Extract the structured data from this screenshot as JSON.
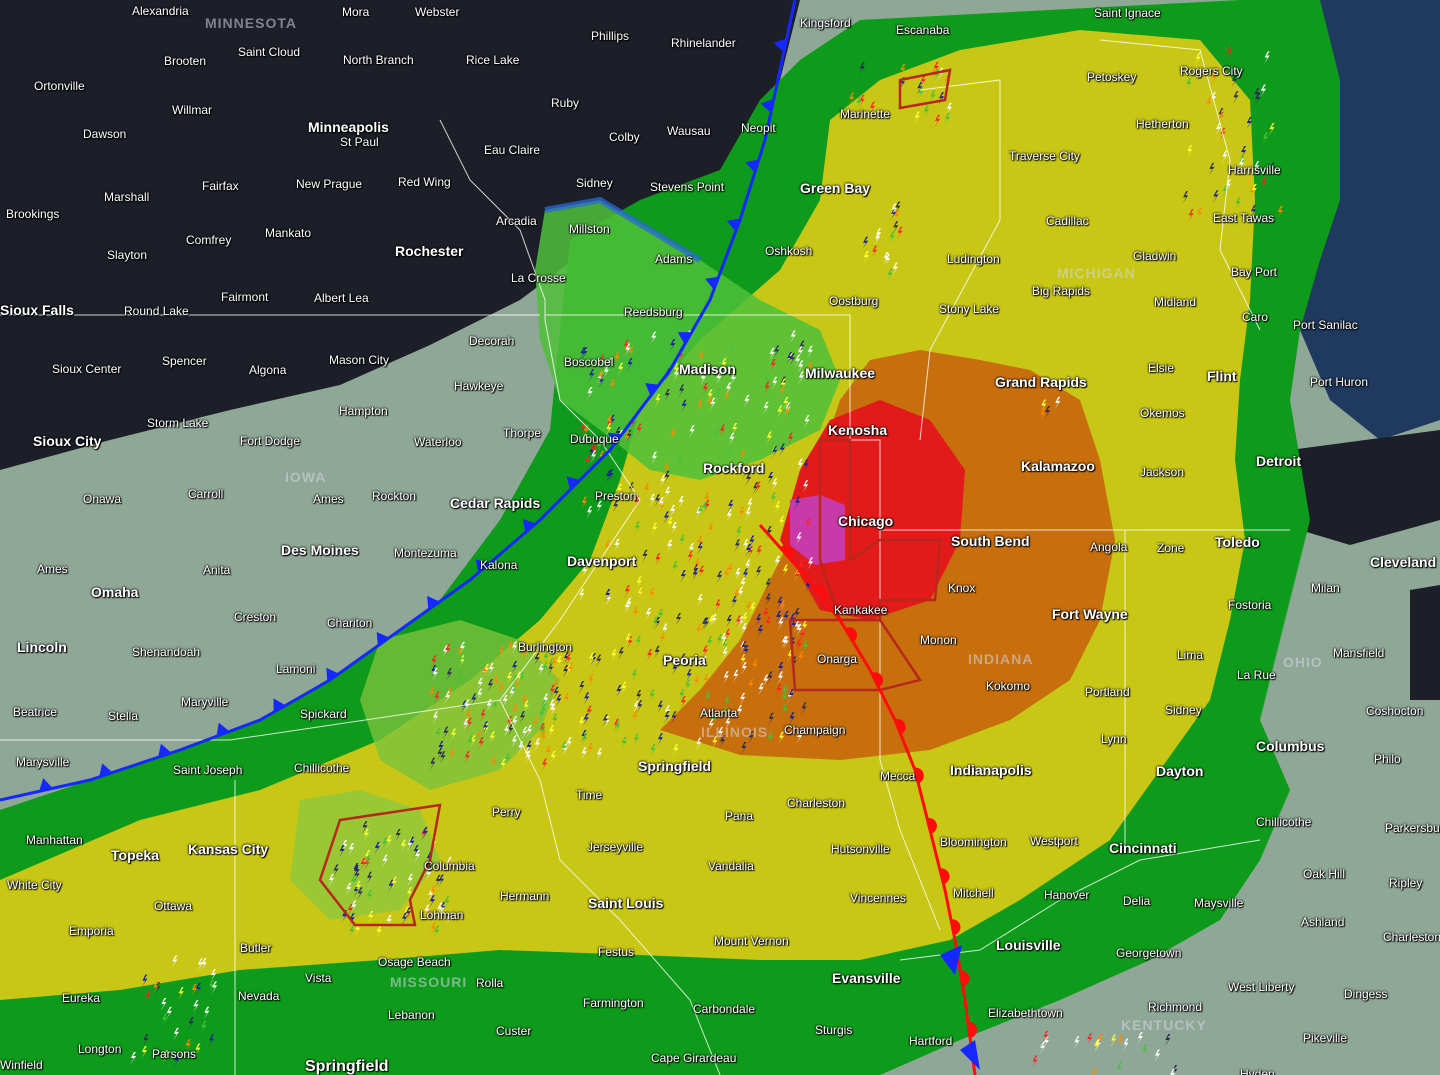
{
  "map": {
    "colors": {
      "background": "#1c1f28",
      "lake": "#1f3a5e",
      "risk_marginal": "#8fa796",
      "risk_general": "#0e9a1a",
      "risk_slight": "#c8c715",
      "risk_enhanced": "#c76e0d",
      "risk_moderate": "#e31a1a",
      "risk_high": "#c83aa8",
      "cold_front": "#1428ff",
      "warm_front": "#ff0c0c",
      "warning_polygon": "#b7271b",
      "state_border": "#ffffff"
    },
    "state_labels": [
      "MINNESOTA",
      "IOWA",
      "ILLINOIS",
      "INDIANA",
      "MICHIGAN",
      "MISSOURI",
      "OHIO",
      "KENTUCKY"
    ],
    "cities": [
      {
        "id": "alexandria",
        "name": "Alexandria"
      },
      {
        "id": "mora",
        "name": "Mora"
      },
      {
        "id": "webster",
        "name": "Webster"
      },
      {
        "id": "kingsford",
        "name": "Kingsford"
      },
      {
        "id": "escanaba",
        "name": "Escanaba"
      },
      {
        "id": "saint-ignace",
        "name": "Saint Ignace"
      },
      {
        "id": "saint-cloud",
        "name": "Saint Cloud"
      },
      {
        "id": "brooten",
        "name": "Brooten"
      },
      {
        "id": "north-branch",
        "name": "North Branch"
      },
      {
        "id": "phillips",
        "name": "Phillips"
      },
      {
        "id": "rhinelander",
        "name": "Rhinelander"
      },
      {
        "id": "rice-lake",
        "name": "Rice Lake"
      },
      {
        "id": "petoskey",
        "name": "Petoskey"
      },
      {
        "id": "rogers-city",
        "name": "Rogers City"
      },
      {
        "id": "ortonville",
        "name": "Ortonville"
      },
      {
        "id": "willmar",
        "name": "Willmar"
      },
      {
        "id": "ruby",
        "name": "Ruby"
      },
      {
        "id": "menominee-hint",
        "name": "Marinette"
      },
      {
        "id": "minneapolis",
        "name": "Minneapolis"
      },
      {
        "id": "st-paul",
        "name": "St Paul"
      },
      {
        "id": "eau-claire",
        "name": "Eau Claire"
      },
      {
        "id": "wausau",
        "name": "Wausau"
      },
      {
        "id": "neopit",
        "name": "Neopit"
      },
      {
        "id": "colby",
        "name": "Colby"
      },
      {
        "id": "hetherton",
        "name": "Hetherton"
      },
      {
        "id": "dawson",
        "name": "Dawson"
      },
      {
        "id": "traverse-city",
        "name": "Traverse City"
      },
      {
        "id": "harrisville",
        "name": "Harrisville"
      },
      {
        "id": "fairfax",
        "name": "Fairfax"
      },
      {
        "id": "new-prague",
        "name": "New Prague"
      },
      {
        "id": "red-wing",
        "name": "Red Wing"
      },
      {
        "id": "sidney-wi",
        "name": "Sidney"
      },
      {
        "id": "stevens-point",
        "name": "Stevens Point"
      },
      {
        "id": "green-bay",
        "name": "Green Bay"
      },
      {
        "id": "marshall",
        "name": "Marshall"
      },
      {
        "id": "brookings",
        "name": "Brookings"
      },
      {
        "id": "cadillac",
        "name": "Cadillac"
      },
      {
        "id": "east-tawas",
        "name": "East Tawas"
      },
      {
        "id": "arcadia",
        "name": "Arcadia"
      },
      {
        "id": "millston",
        "name": "Millston"
      },
      {
        "id": "mankato",
        "name": "Mankato"
      },
      {
        "id": "comfrey",
        "name": "Comfrey"
      },
      {
        "id": "rochester",
        "name": "Rochester"
      },
      {
        "id": "oshkosh",
        "name": "Oshkosh"
      },
      {
        "id": "slayton",
        "name": "Slayton"
      },
      {
        "id": "adams",
        "name": "Adams"
      },
      {
        "id": "ludington",
        "name": "Ludington"
      },
      {
        "id": "gladwin",
        "name": "Gladwin"
      },
      {
        "id": "bay-port",
        "name": "Bay Port"
      },
      {
        "id": "la-crosse",
        "name": "La Crosse"
      },
      {
        "id": "fairmont",
        "name": "Fairmont"
      },
      {
        "id": "albert-lea",
        "name": "Albert Lea"
      },
      {
        "id": "big-rapids",
        "name": "Big Rapids"
      },
      {
        "id": "sioux-falls",
        "name": "Sioux Falls"
      },
      {
        "id": "round-lake",
        "name": "Round Lake"
      },
      {
        "id": "oostburg",
        "name": "Oostburg"
      },
      {
        "id": "midland",
        "name": "Midland"
      },
      {
        "id": "reedsburg",
        "name": "Reedsburg"
      },
      {
        "id": "stony-lake",
        "name": "Stony Lake"
      },
      {
        "id": "caro",
        "name": "Caro"
      },
      {
        "id": "port-sanilac",
        "name": "Port Sanilac"
      },
      {
        "id": "decorah",
        "name": "Decorah"
      },
      {
        "id": "spencer",
        "name": "Spencer"
      },
      {
        "id": "mason-city",
        "name": "Mason City"
      },
      {
        "id": "boscobel",
        "name": "Boscobel"
      },
      {
        "id": "madison",
        "name": "Madison"
      },
      {
        "id": "sioux-center",
        "name": "Sioux Center"
      },
      {
        "id": "algona",
        "name": "Algona"
      },
      {
        "id": "milwaukee",
        "name": "Milwaukee"
      },
      {
        "id": "elsie",
        "name": "Elsie"
      },
      {
        "id": "flint",
        "name": "Flint"
      },
      {
        "id": "port-huron",
        "name": "Port Huron"
      },
      {
        "id": "hawkeye",
        "name": "Hawkeye"
      },
      {
        "id": "grand-rapids",
        "name": "Grand Rapids"
      },
      {
        "id": "hampton",
        "name": "Hampton"
      },
      {
        "id": "okemos",
        "name": "Okemos"
      },
      {
        "id": "storm-lake",
        "name": "Storm Lake"
      },
      {
        "id": "kenosha",
        "name": "Kenosha"
      },
      {
        "id": "sioux-city",
        "name": "Sioux City"
      },
      {
        "id": "thorpe",
        "name": "Thorpe"
      },
      {
        "id": "dubuque",
        "name": "Dubuque"
      },
      {
        "id": "fort-dodge",
        "name": "Fort Dodge"
      },
      {
        "id": "waterloo",
        "name": "Waterloo"
      },
      {
        "id": "detroit",
        "name": "Detroit"
      },
      {
        "id": "kalamazoo",
        "name": "Kalamazoo"
      },
      {
        "id": "rockford",
        "name": "Rockford"
      },
      {
        "id": "jackson",
        "name": "Jackson"
      },
      {
        "id": "onawa",
        "name": "Onawa"
      },
      {
        "id": "carroll",
        "name": "Carroll"
      },
      {
        "id": "ames",
        "name": "Ames"
      },
      {
        "id": "rockton",
        "name": "Rockton"
      },
      {
        "id": "preston",
        "name": "Preston"
      },
      {
        "id": "cedar-rapids",
        "name": "Cedar Rapids"
      },
      {
        "id": "chicago",
        "name": "Chicago"
      },
      {
        "id": "south-bend",
        "name": "South Bend"
      },
      {
        "id": "angola",
        "name": "Angola"
      },
      {
        "id": "zone",
        "name": "Zone"
      },
      {
        "id": "toledo",
        "name": "Toledo"
      },
      {
        "id": "des-moines",
        "name": "Des Moines"
      },
      {
        "id": "montezuma",
        "name": "Montezuma"
      },
      {
        "id": "cleveland",
        "name": "Cleveland"
      },
      {
        "id": "davenport",
        "name": "Davenport"
      },
      {
        "id": "ames-ne",
        "name": "Ames"
      },
      {
        "id": "anita",
        "name": "Anita"
      },
      {
        "id": "kalona",
        "name": "Kalona"
      },
      {
        "id": "knox",
        "name": "Knox"
      },
      {
        "id": "omaha",
        "name": "Omaha"
      },
      {
        "id": "milan",
        "name": "Milan"
      },
      {
        "id": "fostoria",
        "name": "Fostoria"
      },
      {
        "id": "fort-wayne",
        "name": "Fort Wayne"
      },
      {
        "id": "kankakee",
        "name": "Kankakee"
      },
      {
        "id": "creston",
        "name": "Creston"
      },
      {
        "id": "chariton",
        "name": "Chariton"
      },
      {
        "id": "lincoln",
        "name": "Lincoln"
      },
      {
        "id": "monon",
        "name": "Monon"
      },
      {
        "id": "burlington",
        "name": "Burlington"
      },
      {
        "id": "shenandoah",
        "name": "Shenandoah"
      },
      {
        "id": "onarga",
        "name": "Onarga"
      },
      {
        "id": "lima",
        "name": "Lima"
      },
      {
        "id": "mansfield",
        "name": "Mansfield"
      },
      {
        "id": "peoria",
        "name": "Peoria"
      },
      {
        "id": "lamoni",
        "name": "Lamoni"
      },
      {
        "id": "la-rue",
        "name": "La Rue"
      },
      {
        "id": "kokomo",
        "name": "Kokomo"
      },
      {
        "id": "portland",
        "name": "Portland"
      },
      {
        "id": "maryville",
        "name": "Maryville"
      },
      {
        "id": "beatrice",
        "name": "Beatrice"
      },
      {
        "id": "stella",
        "name": "Stella"
      },
      {
        "id": "spickard",
        "name": "Spickard"
      },
      {
        "id": "atlanta",
        "name": "Atlanta"
      },
      {
        "id": "sidney-oh",
        "name": "Sidney"
      },
      {
        "id": "coshocton",
        "name": "Coshocton"
      },
      {
        "id": "champaign",
        "name": "Champaign"
      },
      {
        "id": "lynn",
        "name": "Lynn"
      },
      {
        "id": "columbus",
        "name": "Columbus"
      },
      {
        "id": "marysville",
        "name": "Marysville"
      },
      {
        "id": "springfield-il",
        "name": "Springfield"
      },
      {
        "id": "saint-joseph",
        "name": "Saint Joseph"
      },
      {
        "id": "chillicothe-mo",
        "name": "Chillicothe"
      },
      {
        "id": "indianapolis",
        "name": "Indianapolis"
      },
      {
        "id": "dayton",
        "name": "Dayton"
      },
      {
        "id": "philo",
        "name": "Philo"
      },
      {
        "id": "mecca",
        "name": "Mecca"
      },
      {
        "id": "time",
        "name": "Time"
      },
      {
        "id": "charleston",
        "name": "Charleston"
      },
      {
        "id": "perry",
        "name": "Perry"
      },
      {
        "id": "pana",
        "name": "Pana"
      },
      {
        "id": "chillicothe-oh",
        "name": "Chillicothe"
      },
      {
        "id": "parkersburg",
        "name": "Parkersburg"
      },
      {
        "id": "manhattan",
        "name": "Manhattan"
      },
      {
        "id": "bloomington",
        "name": "Bloomington"
      },
      {
        "id": "westport",
        "name": "Westport"
      },
      {
        "id": "topeka",
        "name": "Topeka"
      },
      {
        "id": "kansas-city",
        "name": "Kansas City"
      },
      {
        "id": "jerseyville",
        "name": "Jerseyville"
      },
      {
        "id": "hutsonville",
        "name": "Hutsonville"
      },
      {
        "id": "cincinnati",
        "name": "Cincinnati"
      },
      {
        "id": "columbia",
        "name": "Columbia"
      },
      {
        "id": "vandalia",
        "name": "Vandalia"
      },
      {
        "id": "oak-hill",
        "name": "Oak Hill"
      },
      {
        "id": "white-city",
        "name": "White City"
      },
      {
        "id": "ripley",
        "name": "Ripley"
      },
      {
        "id": "mitchell",
        "name": "Mitchell"
      },
      {
        "id": "hermann",
        "name": "Hermann"
      },
      {
        "id": "hanover",
        "name": "Hanover"
      },
      {
        "id": "vincennes",
        "name": "Vincennes"
      },
      {
        "id": "saint-louis",
        "name": "Saint Louis"
      },
      {
        "id": "ottawa",
        "name": "Ottawa"
      },
      {
        "id": "delia",
        "name": "Delia"
      },
      {
        "id": "maysville",
        "name": "Maysville"
      },
      {
        "id": "lohman",
        "name": "Lohman"
      },
      {
        "id": "ashland",
        "name": "Ashland"
      },
      {
        "id": "emporia",
        "name": "Emporia"
      },
      {
        "id": "charleston-wv",
        "name": "Charleston"
      },
      {
        "id": "mount-vernon",
        "name": "Mount Vernon"
      },
      {
        "id": "butler",
        "name": "Butler"
      },
      {
        "id": "festus",
        "name": "Festus"
      },
      {
        "id": "louisville",
        "name": "Louisville"
      },
      {
        "id": "georgetown",
        "name": "Georgetown"
      },
      {
        "id": "osage-beach",
        "name": "Osage Beach"
      },
      {
        "id": "vista",
        "name": "Vista"
      },
      {
        "id": "evansville",
        "name": "Evansville"
      },
      {
        "id": "rolla",
        "name": "Rolla"
      },
      {
        "id": "west-liberty",
        "name": "West Liberty"
      },
      {
        "id": "nevada",
        "name": "Nevada"
      },
      {
        "id": "eureka",
        "name": "Eureka"
      },
      {
        "id": "dingess",
        "name": "Dingess"
      },
      {
        "id": "farmington",
        "name": "Farmington"
      },
      {
        "id": "richmond",
        "name": "Richmond"
      },
      {
        "id": "carbondale",
        "name": "Carbondale"
      },
      {
        "id": "elizabethtown",
        "name": "Elizabethtown"
      },
      {
        "id": "lebanon",
        "name": "Lebanon"
      },
      {
        "id": "sturgis",
        "name": "Sturgis"
      },
      {
        "id": "custer",
        "name": "Custer"
      },
      {
        "id": "pikeville",
        "name": "Pikeville"
      },
      {
        "id": "hartford",
        "name": "Hartford"
      },
      {
        "id": "longton",
        "name": "Longton"
      },
      {
        "id": "parsons",
        "name": "Parsons"
      },
      {
        "id": "cape-girardeau",
        "name": "Cape Girardeau"
      },
      {
        "id": "springfield-mo",
        "name": "Springfield"
      },
      {
        "id": "hyden",
        "name": "Hyden"
      },
      {
        "id": "winfield",
        "name": "Winfield"
      }
    ]
  }
}
